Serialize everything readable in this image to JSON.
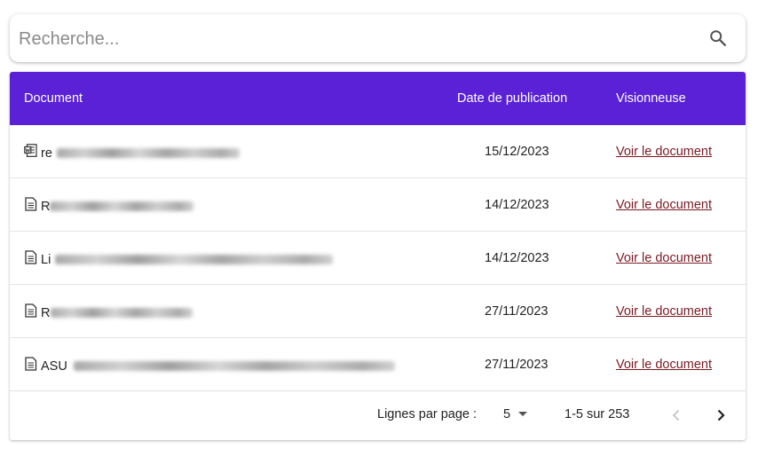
{
  "search": {
    "placeholder": "Recherche...",
    "value": ""
  },
  "table": {
    "headers": {
      "document": "Document",
      "date": "Date de publication",
      "viewer": "Visionneuse"
    },
    "rows": [
      {
        "icon": "word-document-icon",
        "name_visible": "re",
        "date": "15/12/2023",
        "link": "Voir le document"
      },
      {
        "icon": "text-document-icon",
        "name_visible": "R",
        "date": "14/12/2023",
        "link": "Voir le document"
      },
      {
        "icon": "text-document-icon",
        "name_visible": "Li",
        "date": "14/12/2023",
        "link": "Voir le document"
      },
      {
        "icon": "text-document-icon",
        "name_visible": "R",
        "date": "27/11/2023",
        "link": "Voir le document"
      },
      {
        "icon": "text-document-icon",
        "name_visible": "ASU",
        "date": "27/11/2023",
        "link": "Voir le document"
      }
    ]
  },
  "pagination": {
    "rows_per_page_label": "Lignes par page :",
    "rows_per_page": "5",
    "range": "1-5 sur 253"
  },
  "colors": {
    "header_bg": "#5b21d6",
    "link": "#7b1a24"
  }
}
